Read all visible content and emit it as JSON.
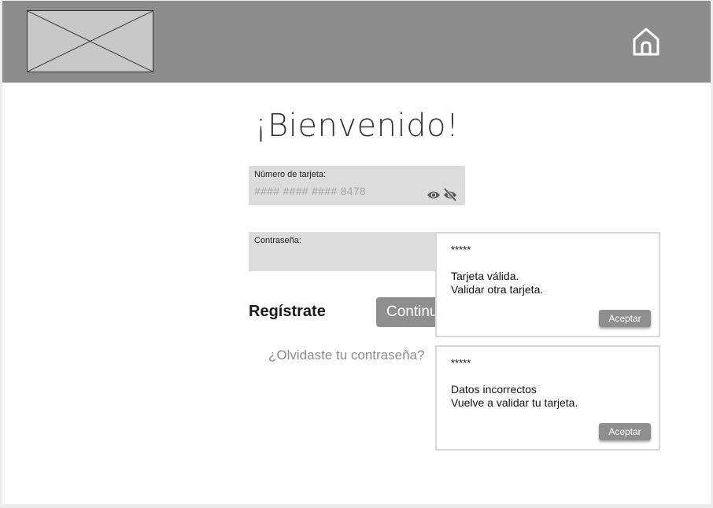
{
  "header": {
    "logo": "image-placeholder",
    "home_icon": "home-icon"
  },
  "login": {
    "title": "¡Bienvenido!",
    "card_field": {
      "label": "Número de tarjeta:",
      "value": "#### #### #### 8478",
      "show_icon": "eye-icon",
      "hide_icon": "eye-off-icon"
    },
    "password_field": {
      "label": "Contraseña:",
      "value": ""
    },
    "register_label": "Regístrate",
    "continue_label": "Continuar",
    "forgot_label": "¿Olvidaste tu contraseña?"
  },
  "dialogs": [
    {
      "masked": "*****",
      "line1": "Tarjeta válida.",
      "line2": "Validar otra tarjeta.",
      "button_label": "Aceptar"
    },
    {
      "masked": "*****",
      "line1": "Datos incorrectos",
      "line2": "Vuelve a validar tu tarjeta.",
      "button_label": "Aceptar"
    }
  ],
  "colors": {
    "header_bg": "#8c8c8c",
    "field_bg": "#dcdcdc",
    "button_bg": "#8f8f8f"
  }
}
